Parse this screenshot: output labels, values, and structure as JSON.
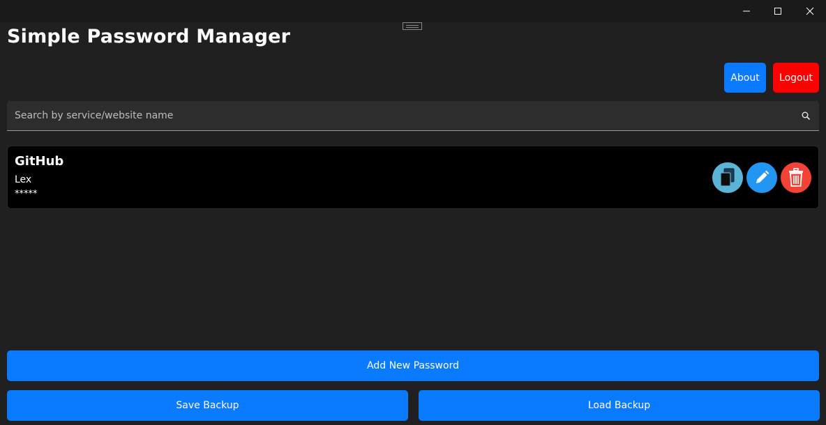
{
  "app": {
    "title": "Simple Password Manager"
  },
  "header": {
    "about_label": "About",
    "logout_label": "Logout"
  },
  "search": {
    "placeholder": "Search by service/website name",
    "value": ""
  },
  "entries": [
    {
      "service": "GitHub",
      "username": "Lex",
      "password_mask": "*****"
    }
  ],
  "actions": {
    "add_label": "Add New Password",
    "save_backup_label": "Save Backup",
    "load_backup_label": "Load Backup"
  },
  "icons": {
    "copy": "copy-icon",
    "edit": "pencil-icon",
    "delete": "trash-icon",
    "search": "search-icon"
  },
  "colors": {
    "background": "#202020",
    "primary": "#0a7bff",
    "danger": "#ff0000",
    "copy_button": "#5ab4d6",
    "edit_button": "#2196f3",
    "delete_button": "#f44336"
  }
}
